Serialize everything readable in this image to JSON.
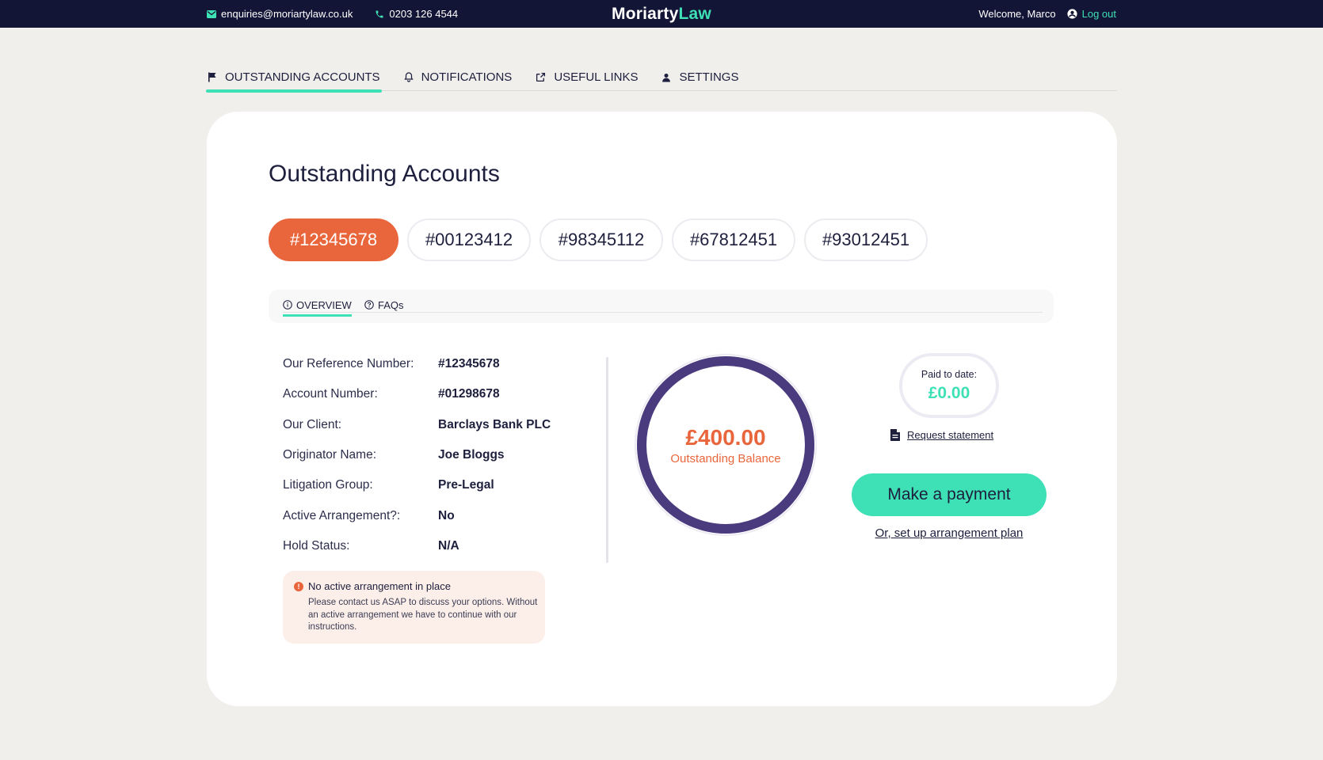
{
  "topbar": {
    "email": "enquiries@moriartylaw.co.uk",
    "phone": "0203 126 4544",
    "logo_main": "Moriarty",
    "logo_accent": "Law",
    "welcome": "Welcome, Marco",
    "logout": "Log out"
  },
  "nav": {
    "tabs": [
      {
        "label": "OUTSTANDING ACCOUNTS",
        "icon": "flag-icon"
      },
      {
        "label": "NOTIFICATIONS",
        "icon": "bell-icon"
      },
      {
        "label": "USEFUL LINKS",
        "icon": "external-link-icon"
      },
      {
        "label": "SETTINGS",
        "icon": "user-icon"
      }
    ]
  },
  "page": {
    "title": "Outstanding Accounts",
    "accounts": [
      "#12345678",
      "#00123412",
      "#98345112",
      "#67812451",
      "#93012451"
    ],
    "subtabs": [
      {
        "label": "OVERVIEW",
        "icon": "info-icon"
      },
      {
        "label": "FAQs",
        "icon": "question-icon"
      }
    ]
  },
  "details": [
    {
      "key": "Our Reference Number:",
      "value": "#12345678"
    },
    {
      "key": "Account Number:",
      "value": "#01298678"
    },
    {
      "key": "Our Client:",
      "value": "Barclays Bank PLC"
    },
    {
      "key": "Originator Name:",
      "value": "Joe Bloggs"
    },
    {
      "key": "Litigation Group:",
      "value": "Pre-Legal"
    },
    {
      "key": "Active Arrangement?:",
      "value": "No"
    },
    {
      "key": "Hold Status:",
      "value": "N/A"
    }
  ],
  "alert": {
    "title": "No active arrangement in place",
    "body": "Please contact us ASAP to discuss your options. Without an active arrangement we have to continue with our instructions."
  },
  "balance": {
    "amount": "£400.00",
    "label": "Outstanding Balance"
  },
  "paid": {
    "label": "Paid to date:",
    "amount": "£0.00"
  },
  "actions": {
    "request_statement": "Request statement",
    "make_payment": "Make a payment",
    "arrangement_plan": "Or, set up arrangement plan"
  },
  "colors": {
    "navy": "#131536",
    "accent_green": "#3ee0b5",
    "accent_orange": "#e9663c",
    "ring_purple": "#4a3a7e"
  }
}
